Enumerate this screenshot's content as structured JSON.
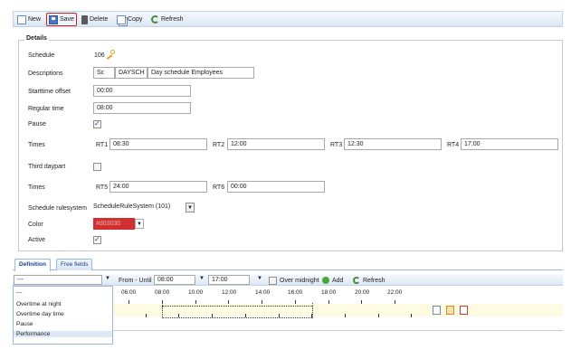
{
  "toolbar": {
    "new_label": "New",
    "save_label": "Save",
    "delete_label": "Delete",
    "copy_label": "Copy",
    "refresh_label": "Refresh"
  },
  "details": {
    "legend": "Details",
    "schedule_label": "Schedule",
    "schedule_value": "106",
    "descriptions_label": "Descriptions",
    "desc_lang": "Sc",
    "desc_code": "DAYSCH",
    "desc_text": "Day schedule Employees",
    "starttime_offset_label": "Starttime offset",
    "starttime_offset_value": "00:00",
    "regular_time_label": "Regular time",
    "regular_time_value": "08:00",
    "pause_label": "Pause",
    "pause_checked": true,
    "times_label": "Times",
    "rt1_label": "RT1",
    "rt1_value": "08:30",
    "rt2_label": "RT2",
    "rt2_value": "12:00",
    "rt3_label": "RT3",
    "rt3_value": "12:30",
    "rt4_label": "RT4",
    "rt4_value": "17:00",
    "third_daypart_label": "Third daypart",
    "third_daypart_checked": false,
    "times2_label": "Times",
    "rt5_label": "RT5",
    "rt5_value": "24:00",
    "rt6_label": "RT6",
    "rt6_value": "00:00",
    "rulesystem_label": "Schedule rulesystem",
    "rulesystem_value": "ScheduleRuleSystem (101)",
    "color_label": "Color",
    "color_value": "#d03030",
    "active_label": "Active",
    "active_checked": true
  },
  "tabs": {
    "definition": "Definition",
    "free_fields": "Free fields"
  },
  "definition": {
    "type_select_value": "---",
    "from_until_label": "From - Until :",
    "from_value": "08:00",
    "until_value": "17:00",
    "over_midnight_label": "Over midnight",
    "add_label": "Add",
    "refresh_label": "Refresh",
    "hours": [
      "06:00",
      "08:00",
      "10:00",
      "12:00",
      "14:00",
      "16:00",
      "18:00",
      "20:00",
      "22:00"
    ],
    "dropdown_options": [
      "---",
      "Overtime at night",
      "Overtime day time",
      "Pause",
      "Performance"
    ],
    "highlighted_option": "Performance"
  },
  "icons": {
    "new": "new-document-icon",
    "save": "save-icon",
    "delete": "delete-icon",
    "copy": "copy-icon",
    "refresh": "refresh-icon",
    "key": "key-icon",
    "add": "add-icon"
  },
  "colors": {
    "accent": "#15428b",
    "highlight_border": "#d41e1e",
    "timeline_bg": "#fdfbe1",
    "selected_color": "#d03030"
  }
}
